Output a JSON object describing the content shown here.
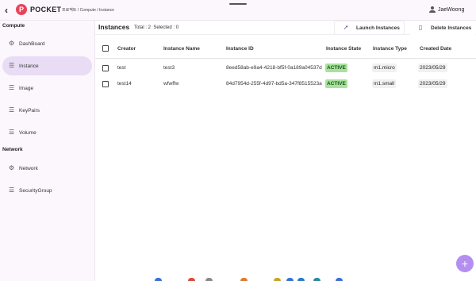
{
  "app": {
    "brand": "POCKET",
    "logo_letter": "P",
    "breadcrumb": "프로젝트 / Compute / Instance",
    "user_name": "JaeWoong"
  },
  "sidebar": {
    "compute_title": "Compute",
    "compute_items": [
      {
        "label": "DashBoard",
        "icon": "dashboard-icon"
      },
      {
        "label": "Instance",
        "icon": "list-icon"
      },
      {
        "label": "Image",
        "icon": "list-icon"
      },
      {
        "label": "KeyPairs",
        "icon": "list-icon"
      },
      {
        "label": "Volume",
        "icon": "list-icon"
      }
    ],
    "network_title": "Network",
    "network_items": [
      {
        "label": "Network",
        "icon": "network-icon"
      },
      {
        "label": "SecurityGroup",
        "icon": "list-icon"
      }
    ]
  },
  "main": {
    "title": "Instances",
    "total_label": "Total : 2",
    "selected_label": "Selected : 0",
    "launch_label": "Launch Instances",
    "delete_label": "Delete Instances"
  },
  "table": {
    "columns": [
      "Creator",
      "Instance Name",
      "Instance ID",
      "Instance State",
      "Instance Type",
      "Created Date"
    ],
    "rows": [
      {
        "creator": "test",
        "name": "test3",
        "id": "8eed58ab-e9a4-4218-bf5f-0a189a04537d",
        "state": "ACTIVE",
        "type": "m1.micro",
        "date": "2023/05/29"
      },
      {
        "creator": "test14",
        "name": "wfwffw",
        "id": "84d7954d-255f-4d97-bd5a-347f8515523a",
        "state": "ACTIVE",
        "type": "m1.small",
        "date": "2023/05/29"
      }
    ]
  },
  "colors": {
    "accent": "#b48ff0",
    "active_nav": "#e9ddf5",
    "state_active": "#a7e39b",
    "logo": "#e8455a"
  },
  "fab": {
    "label": "+"
  }
}
